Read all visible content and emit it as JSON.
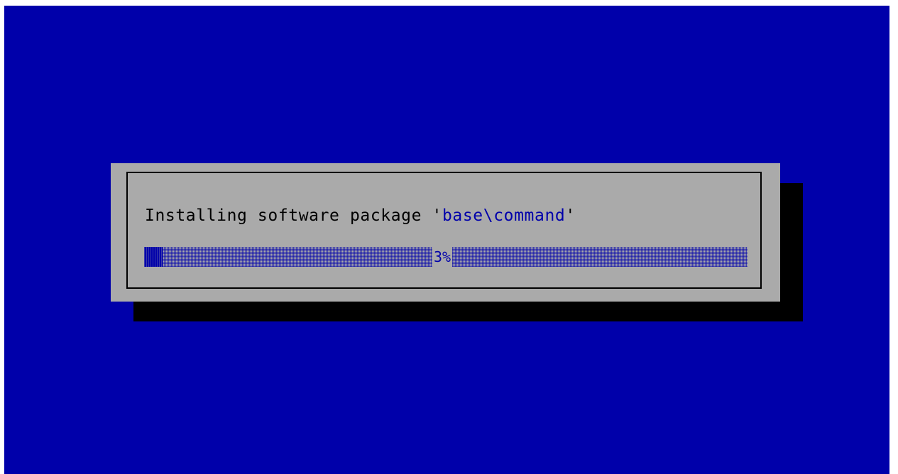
{
  "colors": {
    "background": "#0000aa",
    "dialog": "#aaaaaa",
    "shadow": "#000000",
    "text": "#000000",
    "accent": "#0000aa"
  },
  "dialog": {
    "message_prefix": "Installing software package '",
    "package_name": "base\\command",
    "message_suffix": "'"
  },
  "progress": {
    "percent": 3,
    "label": "3%"
  }
}
